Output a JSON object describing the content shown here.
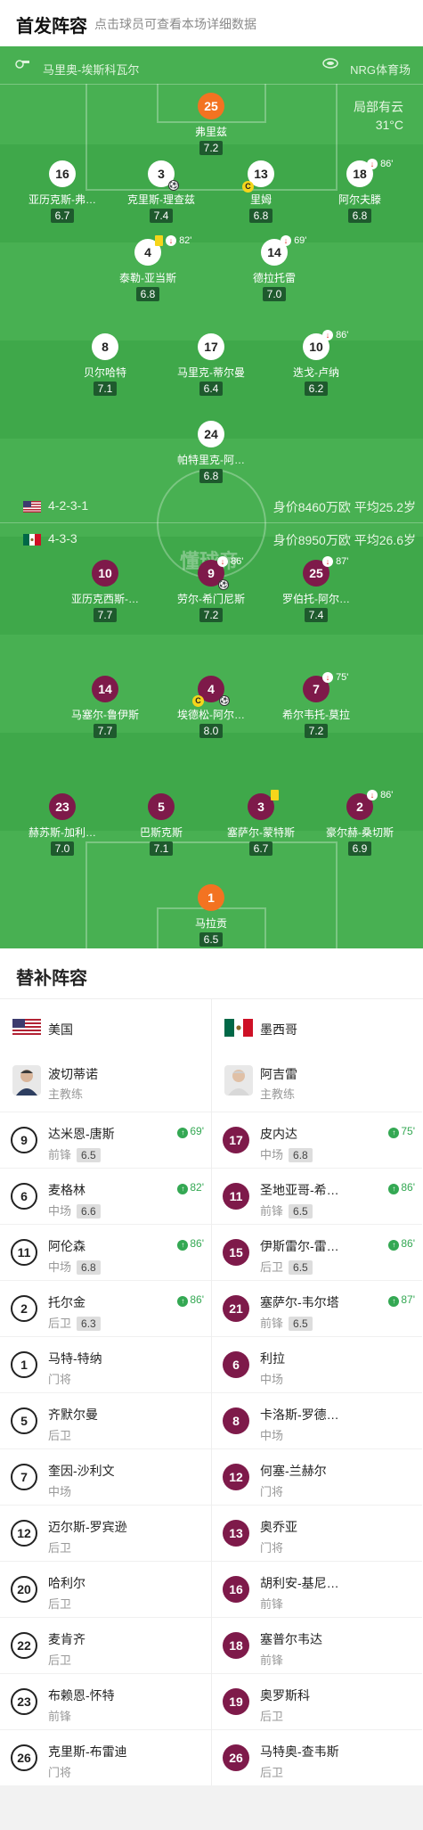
{
  "header": {
    "title": "首发阵容",
    "subtitle": "点击球员可查看本场详细数据"
  },
  "pitch": {
    "referee": "马里奥-埃斯科瓦尔",
    "stadium": "NRG体育场",
    "weather": "局部有云",
    "temperature": "31°C",
    "usa": {
      "formation": "4-2-3-1",
      "value": "身价8460万欧",
      "age": "平均25.2岁"
    },
    "mex": {
      "formation": "4-3-3",
      "value": "身价8950万欧",
      "age": "平均26.6岁"
    },
    "watermark": "懂球帝",
    "usa_players": [
      {
        "num": "25",
        "name": "弗里兹",
        "rating": "7.2"
      },
      {
        "num": "16",
        "name": "亚历克斯-弗…",
        "rating": "6.7"
      },
      {
        "num": "3",
        "name": "克里斯-理查兹",
        "rating": "7.4"
      },
      {
        "num": "13",
        "name": "里姆",
        "rating": "6.8"
      },
      {
        "num": "18",
        "name": "阿尔夫滕",
        "rating": "6.8",
        "sub": "86'"
      },
      {
        "num": "4",
        "name": "泰勒-亚当斯",
        "rating": "6.8",
        "sub": "82'"
      },
      {
        "num": "14",
        "name": "德拉托雷",
        "rating": "7.0",
        "sub": "69'"
      },
      {
        "num": "8",
        "name": "贝尔哈特",
        "rating": "7.1"
      },
      {
        "num": "17",
        "name": "马里克-蒂尔曼",
        "rating": "6.4"
      },
      {
        "num": "10",
        "name": "迭戈-卢纳",
        "rating": "6.2",
        "sub": "86'"
      },
      {
        "num": "24",
        "name": "帕特里克-阿…",
        "rating": "6.8"
      }
    ],
    "mex_players": [
      {
        "num": "10",
        "name": "亚历克西斯-…",
        "rating": "7.7"
      },
      {
        "num": "9",
        "name": "劳尔-希门尼斯",
        "rating": "7.2",
        "sub": "86'"
      },
      {
        "num": "25",
        "name": "罗伯托-阿尔…",
        "rating": "7.4",
        "sub": "87'"
      },
      {
        "num": "14",
        "name": "马塞尔-鲁伊斯",
        "rating": "7.7"
      },
      {
        "num": "4",
        "name": "埃德松-阿尔…",
        "rating": "8.0"
      },
      {
        "num": "7",
        "name": "希尔韦托-莫拉",
        "rating": "7.2",
        "sub": "75'"
      },
      {
        "num": "23",
        "name": "赫苏斯-加利…",
        "rating": "7.0"
      },
      {
        "num": "5",
        "name": "巴斯克斯",
        "rating": "7.1"
      },
      {
        "num": "3",
        "name": "塞萨尔-蒙特斯",
        "rating": "6.7"
      },
      {
        "num": "2",
        "name": "豪尔赫-桑切斯",
        "rating": "6.9",
        "sub": "86'"
      },
      {
        "num": "1",
        "name": "马拉贡",
        "rating": "6.5"
      }
    ]
  },
  "subs": {
    "title": "替补阵容",
    "usa": {
      "team": "美国",
      "coach": {
        "name": "波切蒂诺",
        "role": "主教练"
      },
      "players": [
        {
          "num": "9",
          "name": "达米恩-唐斯",
          "pos": "前锋",
          "rating": "6.5",
          "min": "69'"
        },
        {
          "num": "6",
          "name": "麦格林",
          "pos": "中场",
          "rating": "6.6",
          "min": "82'"
        },
        {
          "num": "11",
          "name": "阿伦森",
          "pos": "中场",
          "rating": "6.8",
          "min": "86'"
        },
        {
          "num": "2",
          "name": "托尔金",
          "pos": "后卫",
          "rating": "6.3",
          "min": "86'"
        },
        {
          "num": "1",
          "name": "马特-特纳",
          "pos": "门将"
        },
        {
          "num": "5",
          "name": "齐默尔曼",
          "pos": "后卫"
        },
        {
          "num": "7",
          "name": "奎因-沙利文",
          "pos": "中场"
        },
        {
          "num": "12",
          "name": "迈尔斯-罗宾逊",
          "pos": "后卫"
        },
        {
          "num": "20",
          "name": "哈利尔",
          "pos": "后卫"
        },
        {
          "num": "22",
          "name": "麦肯齐",
          "pos": "后卫"
        },
        {
          "num": "23",
          "name": "布赖恩-怀特",
          "pos": "前锋"
        },
        {
          "num": "26",
          "name": "克里斯-布雷迪",
          "pos": "门将"
        }
      ]
    },
    "mex": {
      "team": "墨西哥",
      "coach": {
        "name": "阿吉雷",
        "role": "主教练"
      },
      "players": [
        {
          "num": "17",
          "name": "皮内达",
          "pos": "中场",
          "rating": "6.8",
          "min": "75'"
        },
        {
          "num": "11",
          "name": "圣地亚哥-希…",
          "pos": "前锋",
          "rating": "6.5",
          "min": "86'"
        },
        {
          "num": "15",
          "name": "伊斯雷尔-雷…",
          "pos": "后卫",
          "rating": "6.5",
          "min": "86'"
        },
        {
          "num": "21",
          "name": "塞萨尔-韦尔塔",
          "pos": "前锋",
          "rating": "6.5",
          "min": "87'"
        },
        {
          "num": "6",
          "name": "利拉",
          "pos": "中场"
        },
        {
          "num": "8",
          "name": "卡洛斯-罗德…",
          "pos": "中场"
        },
        {
          "num": "12",
          "name": "何塞-兰赫尔",
          "pos": "门将"
        },
        {
          "num": "13",
          "name": "奥乔亚",
          "pos": "门将"
        },
        {
          "num": "16",
          "name": "胡利安-基尼…",
          "pos": "前锋"
        },
        {
          "num": "18",
          "name": "塞普尔韦达",
          "pos": "前锋"
        },
        {
          "num": "19",
          "name": "奥罗斯科",
          "pos": "后卫"
        },
        {
          "num": "26",
          "name": "马特奥-查韦斯",
          "pos": "后卫"
        }
      ]
    }
  },
  "colors": {
    "pitch": "#3fa84a",
    "mex": "#7e1a4a",
    "gk": "#f37321",
    "rating_bg": "#1e5a2d"
  }
}
